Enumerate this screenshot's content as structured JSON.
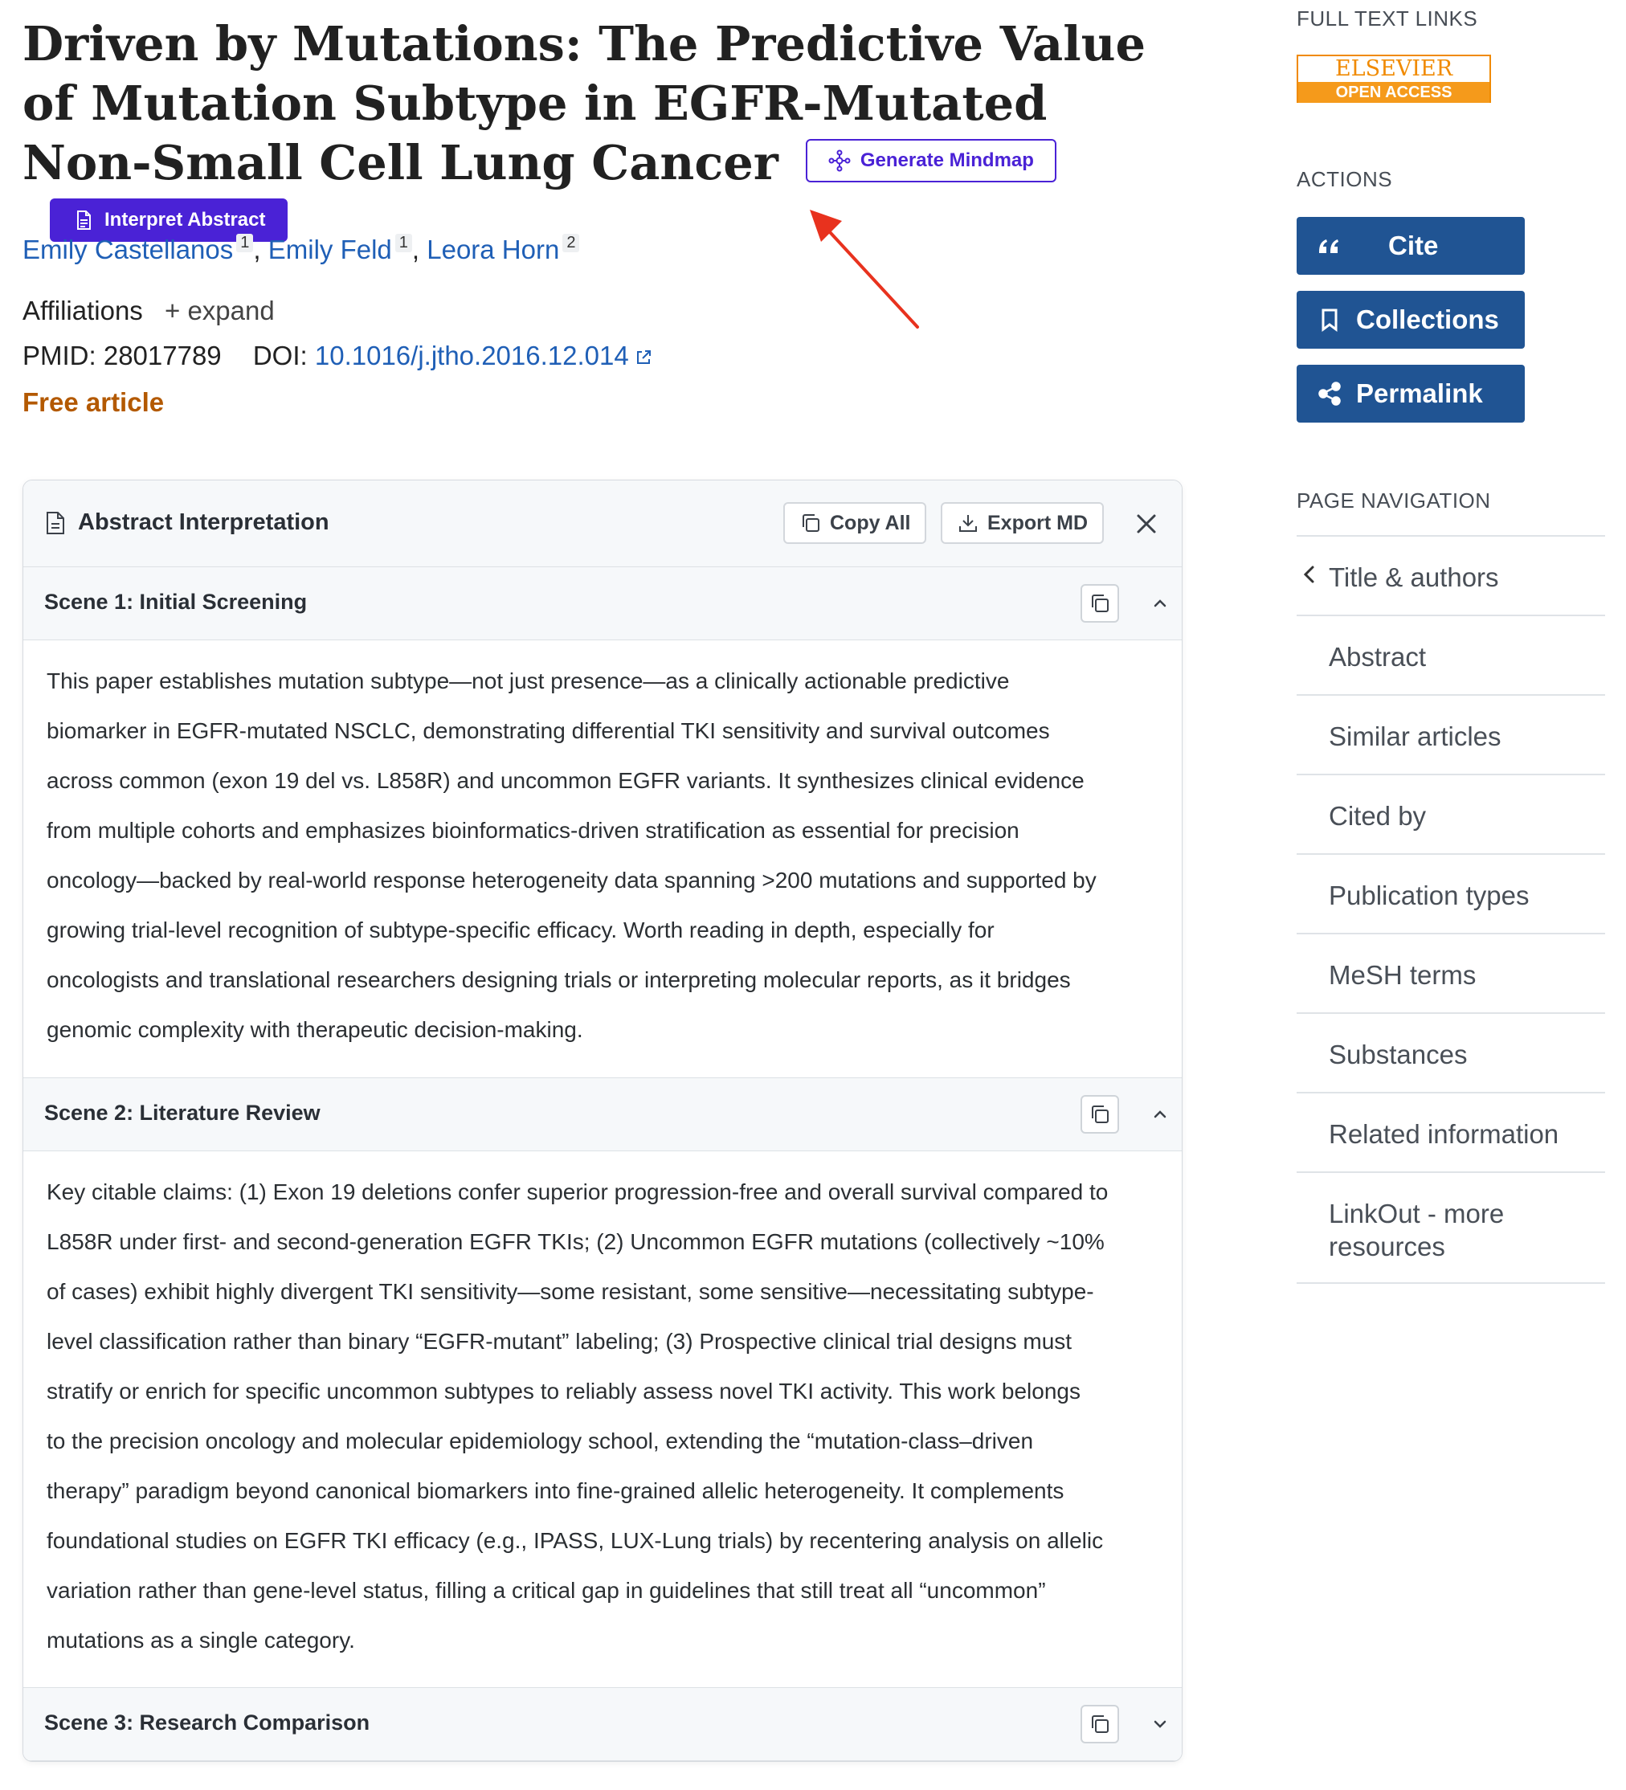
{
  "article": {
    "title": "Driven by Mutations: The Predictive Value of Mutation Subtype in EGFR-Mutated Non-Small Cell Lung Cancer",
    "buttons": {
      "mindmap": "Generate Mindmap",
      "interpret": "Interpret Abstract"
    },
    "authors": [
      {
        "name": "Emily Castellanos",
        "sup": "1"
      },
      {
        "name": "Emily Feld",
        "sup": "1"
      },
      {
        "name": "Leora Horn",
        "sup": "2"
      }
    ],
    "affiliations_label": "Affiliations",
    "expand_label": "expand",
    "pmid": "PMID: 28017789",
    "doi_label": "DOI:",
    "doi": "10.1016/j.jtho.2016.12.014",
    "free_label": "Free article"
  },
  "panel": {
    "title": "Abstract Interpretation",
    "copy_all": "Copy All",
    "export": "Export MD",
    "scenes": [
      {
        "title": "Scene 1: Initial Screening",
        "lines": [
          "This paper establishes mutation subtype—not just presence—as a clinically actionable predictive",
          "biomarker in EGFR-mutated NSCLC, demonstrating differential TKI sensitivity and survival outcomes",
          "across common (exon 19 del vs. L858R) and uncommon EGFR variants. It synthesizes clinical evidence",
          "from multiple cohorts and emphasizes bioinformatics-driven stratification as essential for precision",
          "oncology—backed by real-world response heterogeneity data spanning >200 mutations and supported by",
          "growing trial-level recognition of subtype-specific efficacy. Worth reading in depth, especially for",
          "oncologists and translational researchers designing trials or interpreting molecular reports, as it bridges",
          "genomic complexity with therapeutic decision-making."
        ]
      },
      {
        "title": "Scene 2: Literature Review",
        "lines": [
          "Key citable claims: (1) Exon 19 deletions confer superior progression-free and overall survival compared to",
          "L858R under first- and second-generation EGFR TKIs; (2) Uncommon EGFR mutations (collectively ~10%",
          "of cases) exhibit highly divergent TKI sensitivity—some resistant, some sensitive—necessitating subtype-",
          "level classification rather than binary “EGFR-mutant” labeling; (3) Prospective clinical trial designs must",
          "stratify or enrich for specific uncommon subtypes to reliably assess novel TKI activity. This work belongs",
          "to the precision oncology and molecular epidemiology school, extending the “mutation-class–driven",
          "therapy” paradigm beyond canonical biomarkers into fine-grained allelic heterogeneity. It complements",
          "foundational studies on EGFR TKI efficacy (e.g., IPASS, LUX-Lung trials) by recentering analysis on allelic",
          "variation rather than gene-level status, filling a critical gap in guidelines that still treat all “uncommon”",
          "mutations as a single category."
        ]
      },
      {
        "title": "Scene 3: Research Comparison",
        "lines": []
      }
    ]
  },
  "sidebar": {
    "full_text_heading": "FULL TEXT LINKS",
    "elsevier_top": "ELSEVIER",
    "elsevier_bottom": "OPEN ACCESS",
    "actions_heading": "ACTIONS",
    "actions": [
      "Cite",
      "Collections",
      "Permalink"
    ],
    "nav_heading": "PAGE NAVIGATION",
    "nav": [
      "Title & authors",
      "Abstract",
      "Similar articles",
      "Cited by",
      "Publication types",
      "MeSH terms",
      "Substances",
      "Related information",
      "LinkOut - more resources"
    ]
  },
  "colors": {
    "accent": "#4a22d6",
    "action_blue": "#205493",
    "link": "#1f5fb6",
    "free": "#b35900",
    "annotation": "#e8321e"
  }
}
